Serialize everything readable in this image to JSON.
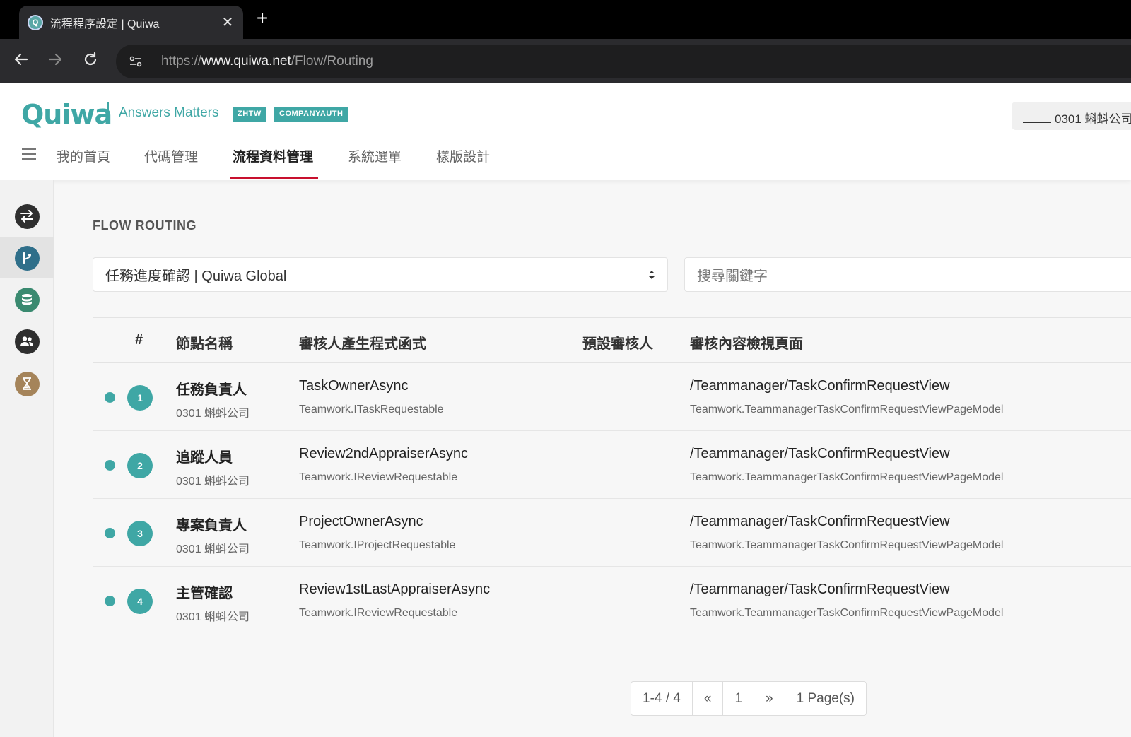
{
  "browser": {
    "tab_title": "流程程序設定 | Quiwa",
    "favicon_letter": "Q",
    "close_glyph": "✕",
    "new_tab_glyph": "+",
    "url_scheme": "https://",
    "url_host": "www.quiwa.net",
    "url_path": "/Flow/Routing"
  },
  "header": {
    "logo": "Quiwa",
    "tagline": "Answers Matters",
    "badges": [
      "ZHTW",
      "COMPANYAUTH"
    ],
    "user": "0301 蝌蚪公司"
  },
  "menu": {
    "items": [
      "我的首頁",
      "代碼管理",
      "流程資料管理",
      "系統選單",
      "樣版設計"
    ],
    "active": "流程資料管理"
  },
  "rail": {
    "items": [
      {
        "icon": "swap-icon",
        "color": "#2f2f2f"
      },
      {
        "icon": "branch-icon",
        "color": "#2f6f8a"
      },
      {
        "icon": "database-icon",
        "color": "#3a8a70"
      },
      {
        "icon": "users-icon",
        "color": "#2f2f2f"
      },
      {
        "icon": "hourglass-icon",
        "color": "#a5845a"
      }
    ]
  },
  "main": {
    "section_title": "FLOW ROUTING",
    "flow_select": "任務進度確認 | Quiwa Global",
    "search_placeholder": "搜尋關鍵字"
  },
  "table": {
    "headers": {
      "index": "#",
      "node": "節點名稱",
      "function": "審核人產生程式函式",
      "default_reviewer": "預設審核人",
      "view_page": "審核內容檢視頁面"
    },
    "rows": [
      {
        "n": "1",
        "node": "任務負責人",
        "company": "0301 蝌蚪公司",
        "func": "TaskOwnerAsync",
        "iface": "Teamwork.ITaskRequestable",
        "default_reviewer": "",
        "view": "/Teammanager/TaskConfirmRequestView",
        "model": "Teamwork.TeammanagerTaskConfirmRequestViewPageModel"
      },
      {
        "n": "2",
        "node": "追蹤人員",
        "company": "0301 蝌蚪公司",
        "func": "Review2ndAppraiserAsync",
        "iface": "Teamwork.IReviewRequestable",
        "default_reviewer": "",
        "view": "/Teammanager/TaskConfirmRequestView",
        "model": "Teamwork.TeammanagerTaskConfirmRequestViewPageModel"
      },
      {
        "n": "3",
        "node": "專案負責人",
        "company": "0301 蝌蚪公司",
        "func": "ProjectOwnerAsync",
        "iface": "Teamwork.IProjectRequestable",
        "default_reviewer": "",
        "view": "/Teammanager/TaskConfirmRequestView",
        "model": "Teamwork.TeammanagerTaskConfirmRequestViewPageModel"
      },
      {
        "n": "4",
        "node": "主管確認",
        "company": "0301 蝌蚪公司",
        "func": "Review1stLastAppraiserAsync",
        "iface": "Teamwork.IReviewRequestable",
        "default_reviewer": "",
        "view": "/Teammanager/TaskConfirmRequestView",
        "model": "Teamwork.TeammanagerTaskConfirmRequestViewPageModel"
      }
    ]
  },
  "pager": {
    "range": "1-4 / 4",
    "prev": "«",
    "page": "1",
    "next": "»",
    "pages": "1 Page(s)"
  }
}
